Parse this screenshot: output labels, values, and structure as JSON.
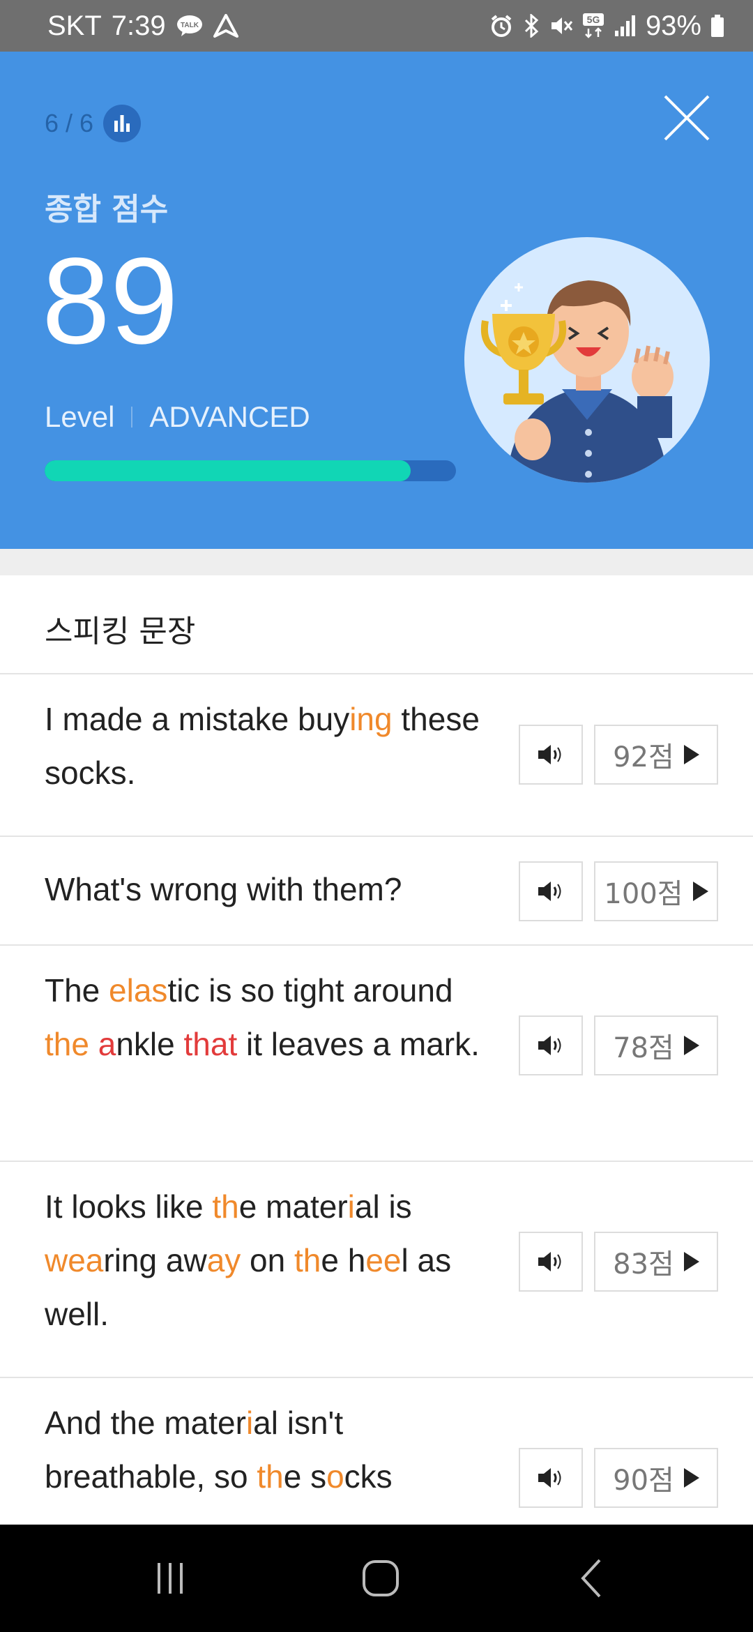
{
  "status_bar": {
    "carrier": "SKT",
    "time": "7:39",
    "talk_badge": "TALK",
    "network": "5G",
    "battery": "93%"
  },
  "header": {
    "progress": "6 / 6",
    "score_label": "종합 점수",
    "score": "89",
    "level_label": "Level",
    "level_value": "ADVANCED",
    "level_progress": 0.89
  },
  "section": {
    "title": "스피킹 문장"
  },
  "sentences": [
    {
      "segments": [
        {
          "t": "I made a mistake buy",
          "c": ""
        },
        {
          "t": "ing",
          "c": "o"
        },
        {
          "t": " these socks.",
          "c": ""
        }
      ],
      "score": "92점"
    },
    {
      "segments": [
        {
          "t": "What's wrong with them?",
          "c": ""
        }
      ],
      "score": "100점"
    },
    {
      "segments": [
        {
          "t": "The ",
          "c": ""
        },
        {
          "t": "elas",
          "c": "o"
        },
        {
          "t": "tic is so tight around ",
          "c": ""
        },
        {
          "t": "the",
          "c": "o"
        },
        {
          "t": " ",
          "c": ""
        },
        {
          "t": "a",
          "c": "r"
        },
        {
          "t": "nkle ",
          "c": ""
        },
        {
          "t": "that",
          "c": "r"
        },
        {
          "t": " it leaves a mark.",
          "c": ""
        }
      ],
      "score": "78점"
    },
    {
      "segments": [
        {
          "t": "It looks like ",
          "c": ""
        },
        {
          "t": "th",
          "c": "o"
        },
        {
          "t": "e mater",
          "c": ""
        },
        {
          "t": "i",
          "c": "o"
        },
        {
          "t": "al is ",
          "c": ""
        },
        {
          "t": "wea",
          "c": "o"
        },
        {
          "t": "ring aw",
          "c": ""
        },
        {
          "t": "ay",
          "c": "o"
        },
        {
          "t": " on ",
          "c": ""
        },
        {
          "t": "th",
          "c": "o"
        },
        {
          "t": "e h",
          "c": ""
        },
        {
          "t": "ee",
          "c": "o"
        },
        {
          "t": "l as well.",
          "c": ""
        }
      ],
      "score": "83점"
    },
    {
      "segments": [
        {
          "t": "And the mater",
          "c": ""
        },
        {
          "t": "i",
          "c": "o"
        },
        {
          "t": "al isn't breathable, so ",
          "c": ""
        },
        {
          "t": "th",
          "c": "o"
        },
        {
          "t": "e s",
          "c": ""
        },
        {
          "t": "o",
          "c": "o"
        },
        {
          "t": "cks",
          "c": ""
        }
      ],
      "score": "90점"
    }
  ],
  "colors": {
    "hero_bg": "#4492e3",
    "accent_teal": "#11d6b5",
    "highlight_orange": "#f0892b",
    "highlight_red": "#e23b3b"
  },
  "icons": {
    "close": "close-icon",
    "stats": "bar-chart-icon",
    "audio": "speaker-icon",
    "play": "play-icon"
  }
}
